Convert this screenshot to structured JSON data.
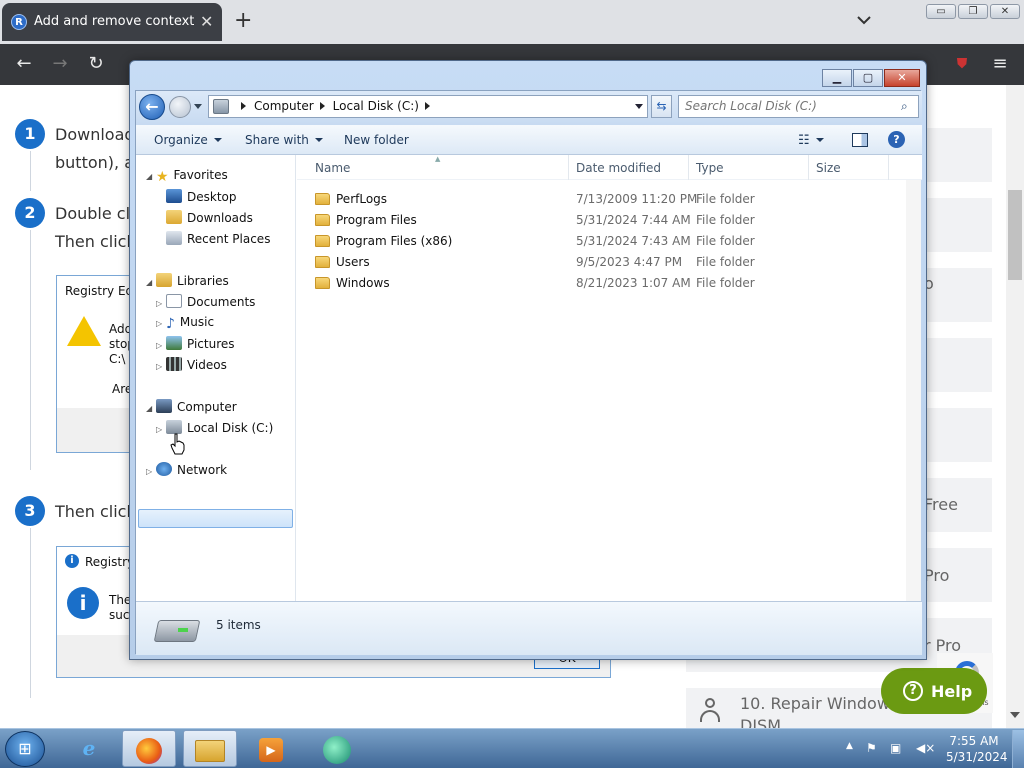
{
  "browser": {
    "tab_title": "Add and remove context menu",
    "tab_favicon": "R",
    "tab_close": "✕",
    "new_tab": "+"
  },
  "webpage": {
    "steps": [
      {
        "num": "1",
        "line1": "Download",
        "line2": "button), a"
      },
      {
        "num": "2",
        "line1": "Double cli",
        "line2": "Then click"
      },
      {
        "num": "3",
        "line1": "Then click",
        "line2": ""
      }
    ],
    "screenshot1": {
      "title": "Registry Edit",
      "line1": "Add",
      "line2": "stop",
      "line3": "C:\\",
      "line4": "Are"
    },
    "screenshot2": {
      "title": "Registry",
      "line1": "The",
      "line2": "suc",
      "ok": "OK"
    },
    "side_fragments": [
      "o",
      "Free",
      "Pro",
      "r Pro"
    ],
    "side_item": {
      "line1": "10. Repair Windows",
      "line2": "DISM"
    },
    "help_button": "Help",
    "recaptcha": "Terms"
  },
  "explorer": {
    "address": {
      "root": "Computer",
      "drive": "Local Disk (C:)"
    },
    "search_placeholder": "Search Local Disk (C:)",
    "commands": {
      "organize": "Organize",
      "share": "Share with",
      "new_folder": "New folder"
    },
    "nav": {
      "favorites": "Favorites",
      "desktop": "Desktop",
      "downloads": "Downloads",
      "recent": "Recent Places",
      "libraries": "Libraries",
      "documents": "Documents",
      "music": "Music",
      "pictures": "Pictures",
      "videos": "Videos",
      "computer": "Computer",
      "local_disk": "Local Disk (C:)",
      "network": "Network"
    },
    "columns": {
      "name": "Name",
      "date": "Date modified",
      "type": "Type",
      "size": "Size"
    },
    "files": [
      {
        "name": "PerfLogs",
        "date": "7/13/2009 11:20 PM",
        "type": "File folder"
      },
      {
        "name": "Program Files",
        "date": "5/31/2024 7:44 AM",
        "type": "File folder"
      },
      {
        "name": "Program Files (x86)",
        "date": "5/31/2024 7:43 AM",
        "type": "File folder"
      },
      {
        "name": "Users",
        "date": "9/5/2023 4:47 PM",
        "type": "File folder"
      },
      {
        "name": "Windows",
        "date": "8/21/2023 1:07 AM",
        "type": "File folder"
      }
    ],
    "status": "5 items"
  },
  "taskbar": {
    "time": "7:55 AM",
    "date": "5/31/2024"
  }
}
